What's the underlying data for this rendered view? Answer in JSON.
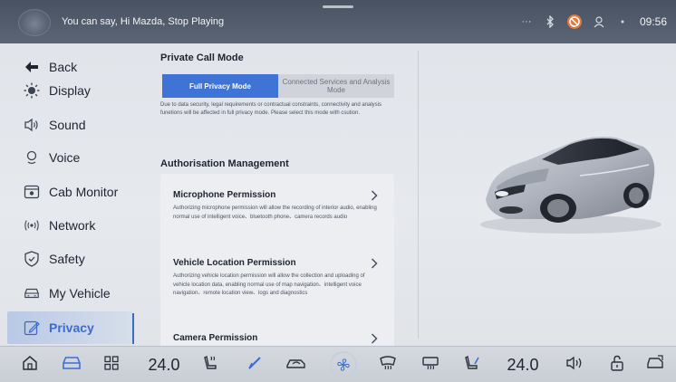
{
  "status_bar": {
    "voice_prompt": "You can say, Hi Mazda, Stop Playing",
    "more_glyph": "···",
    "time": "09:56"
  },
  "sidebar": {
    "back_label": "Back",
    "items": [
      {
        "label": "Display",
        "icon": "sun-icon"
      },
      {
        "label": "Sound",
        "icon": "speaker-icon"
      },
      {
        "label": "Voice",
        "icon": "voice-icon"
      },
      {
        "label": "Cab Monitor",
        "icon": "camera-icon"
      },
      {
        "label": "Network",
        "icon": "network-icon"
      },
      {
        "label": "Safety",
        "icon": "shield-icon"
      },
      {
        "label": "My Vehicle",
        "icon": "car-icon"
      },
      {
        "label": "Privacy",
        "icon": "privacy-icon",
        "active": true
      }
    ]
  },
  "private_call": {
    "title": "Private Call Mode",
    "option_full": "Full Privacy Mode",
    "option_connected": "Connected Services and Analysis Mode",
    "selected": "Full Privacy Mode",
    "note": "Due to data security, legal requirements or contractual constraints, connectivity and analysis funetions will be affected in full privacy mode. Please select this mode with csution."
  },
  "authorisation": {
    "title": "Authorisation Management",
    "permissions": [
      {
        "title": "Microphone Permission",
        "desc": "Authorizing microphone permission will allow the recording of interior audio, enabling normal use of  intelligent voice、bluetooth phone、camera records audio"
      },
      {
        "title": "Vehicle Location Permission",
        "desc": "Authorizing vehicle location permission will allow the collection and uploading of vehicle location data, enabling normal use of map navigation、intelligent voice navigation、remote location view、logs and diagnostics"
      },
      {
        "title": "Camera Permission",
        "desc": ""
      }
    ]
  },
  "dock": {
    "driver_temp": "24.0",
    "passenger_temp": "24.0",
    "items": [
      "home-icon",
      "car-icon",
      "apps-grid-icon",
      "seat-heat-icon",
      "wiper-icon",
      "car-recirculation-icon",
      "fan-icon",
      "front-defrost-icon",
      "rear-defrost-icon",
      "seat-icon",
      "volume-icon",
      "lock-icon",
      "car-view-icon"
    ]
  },
  "colors": {
    "accent": "#3f73d6",
    "active_nav": "#3d6bc6",
    "status_bar": "#4e5767",
    "warning": "#e07a3f"
  }
}
